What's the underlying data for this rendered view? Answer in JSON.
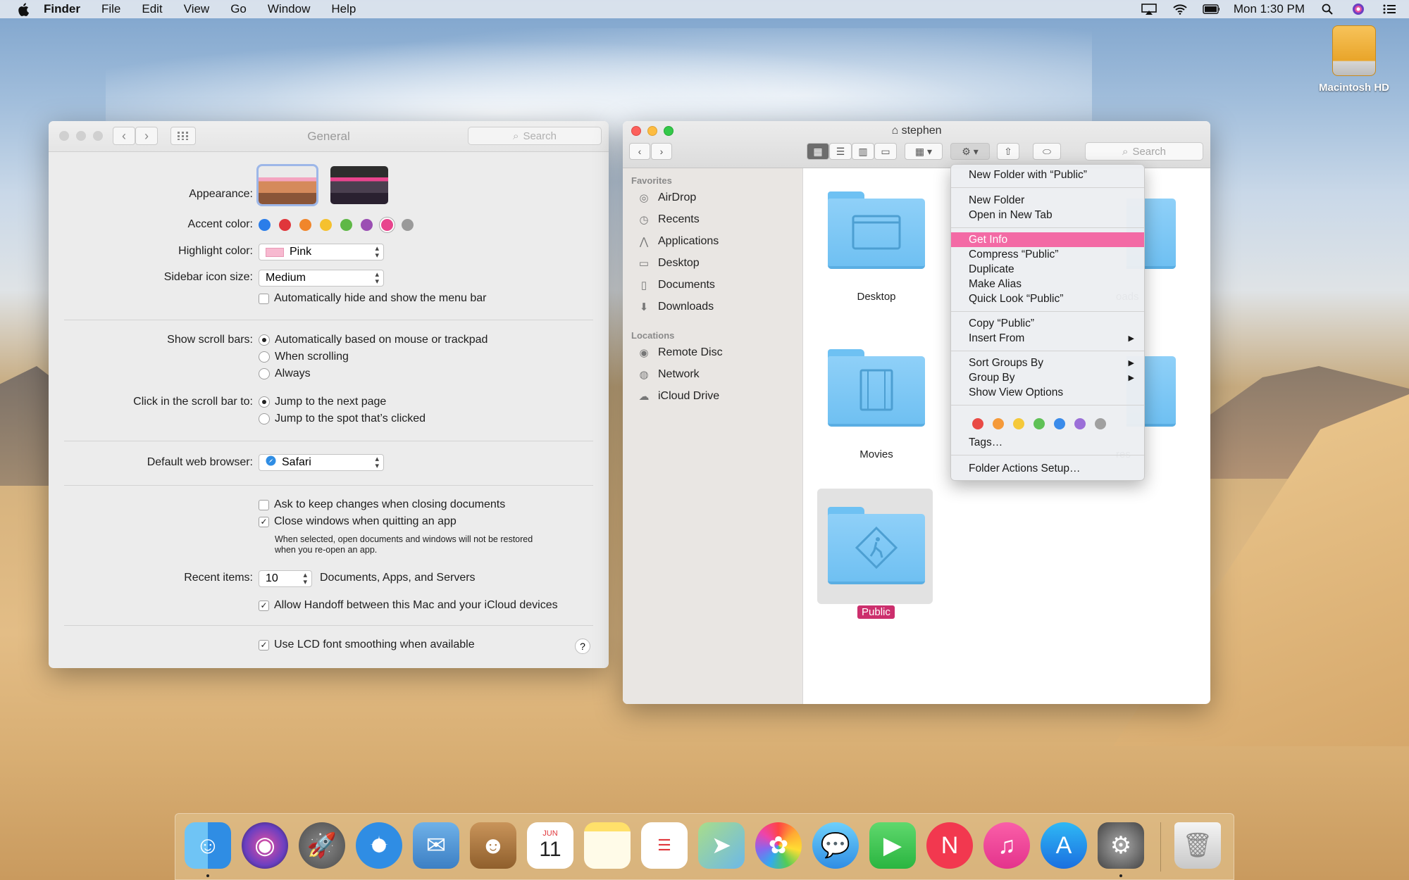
{
  "menubar": {
    "apple_icon": "apple-logo",
    "app_name": "Finder",
    "items": [
      "File",
      "Edit",
      "View",
      "Go",
      "Window",
      "Help"
    ],
    "clock": "Mon 1:30 PM",
    "status_icons": [
      "airplay-icon",
      "wifi-icon",
      "battery-icon",
      "search-icon",
      "siri-icon",
      "notification-center-icon"
    ]
  },
  "desktop": {
    "drive_label": "Macintosh HD"
  },
  "general_window": {
    "title": "General",
    "search_placeholder": "Search",
    "appearance_label": "Appearance:",
    "accent_label": "Accent color:",
    "accent_colors": [
      "#2b7de9",
      "#e0363b",
      "#f0862b",
      "#f5c12e",
      "#5fb846",
      "#9b4fb3",
      "#e8458d",
      "#9a9a9a"
    ],
    "accent_selected": "#e8458d",
    "highlight_label": "Highlight color:",
    "highlight_value": "Pink",
    "sidebar_label": "Sidebar icon size:",
    "sidebar_value": "Medium",
    "autohide_label": "Automatically hide and show the menu bar",
    "autohide_checked": false,
    "scroll_label": "Show scroll bars:",
    "scroll_options": [
      "Automatically based on mouse or trackpad",
      "When scrolling",
      "Always"
    ],
    "scroll_selected": 0,
    "click_label": "Click in the scroll bar to:",
    "click_options": [
      "Jump to the next page",
      "Jump to the spot that’s clicked"
    ],
    "click_selected": 0,
    "browser_label": "Default web browser:",
    "browser_value": "Safari",
    "ask_keep_label": "Ask to keep changes when closing documents",
    "ask_keep_checked": false,
    "close_windows_label": "Close windows when quitting an app",
    "close_windows_checked": true,
    "close_note_line1": "When selected, open documents and windows will not be restored",
    "close_note_line2": "when you re-open an app.",
    "recent_label": "Recent items:",
    "recent_value": "10",
    "recent_suffix": "Documents, Apps, and Servers",
    "handoff_label": "Allow Handoff between this Mac and your iCloud devices",
    "handoff_checked": true,
    "lcd_label": "Use LCD font smoothing when available",
    "lcd_checked": true,
    "help_glyph": "?"
  },
  "finder_window": {
    "title": "stephen",
    "search_placeholder": "Search",
    "sidebar": {
      "favorites_header": "Favorites",
      "favorites": [
        {
          "label": "AirDrop",
          "icon": "airdrop-icon"
        },
        {
          "label": "Recents",
          "icon": "recents-icon"
        },
        {
          "label": "Applications",
          "icon": "applications-icon"
        },
        {
          "label": "Desktop",
          "icon": "desktop-icon"
        },
        {
          "label": "Documents",
          "icon": "documents-icon"
        },
        {
          "label": "Downloads",
          "icon": "downloads-icon"
        }
      ],
      "locations_header": "Locations",
      "locations": [
        {
          "label": "Remote Disc",
          "icon": "disc-icon"
        },
        {
          "label": "Network",
          "icon": "network-icon"
        },
        {
          "label": "iCloud Drive",
          "icon": "icloud-icon"
        }
      ]
    },
    "folders": [
      {
        "label": "Desktop",
        "icon": "desktop-folder-icon"
      },
      {
        "label": "Movies",
        "icon": "movies-folder-icon"
      },
      {
        "label": "Public",
        "icon": "public-folder-icon",
        "selected": true
      }
    ],
    "partial_labels": [
      "oads",
      "res"
    ]
  },
  "context_menu": {
    "groups": [
      [
        "New Folder with “Public”"
      ],
      [
        "New Folder",
        "Open in New Tab"
      ],
      [
        "Get Info",
        "Compress “Public”",
        "Duplicate",
        "Make Alias",
        "Quick Look “Public”"
      ],
      [
        "Copy “Public”",
        "Insert From"
      ],
      [
        "Sort Groups By",
        "Group By",
        "Show View Options"
      ]
    ],
    "highlighted": "Get Info",
    "tag_colors": [
      "#e94a45",
      "#f59a3a",
      "#f5c93a",
      "#5fc156",
      "#3a8bea",
      "#9b6fd8",
      "#a0a0a0"
    ],
    "tags_label": "Tags…",
    "folder_actions_label": "Folder Actions Setup…",
    "submenu_glyph": "▶"
  },
  "dock": {
    "apps": [
      "finder-icon",
      "siri-icon",
      "launchpad-icon",
      "safari-icon",
      "mail-icon",
      "contacts-icon",
      "calendar-icon",
      "notes-icon",
      "reminders-icon",
      "maps-icon",
      "photos-icon",
      "messages-icon",
      "facetime-icon",
      "news-icon",
      "itunes-icon",
      "app-store-icon",
      "system-preferences-icon",
      "trash-icon"
    ],
    "calendar_month": "JUN",
    "calendar_day": "11"
  }
}
